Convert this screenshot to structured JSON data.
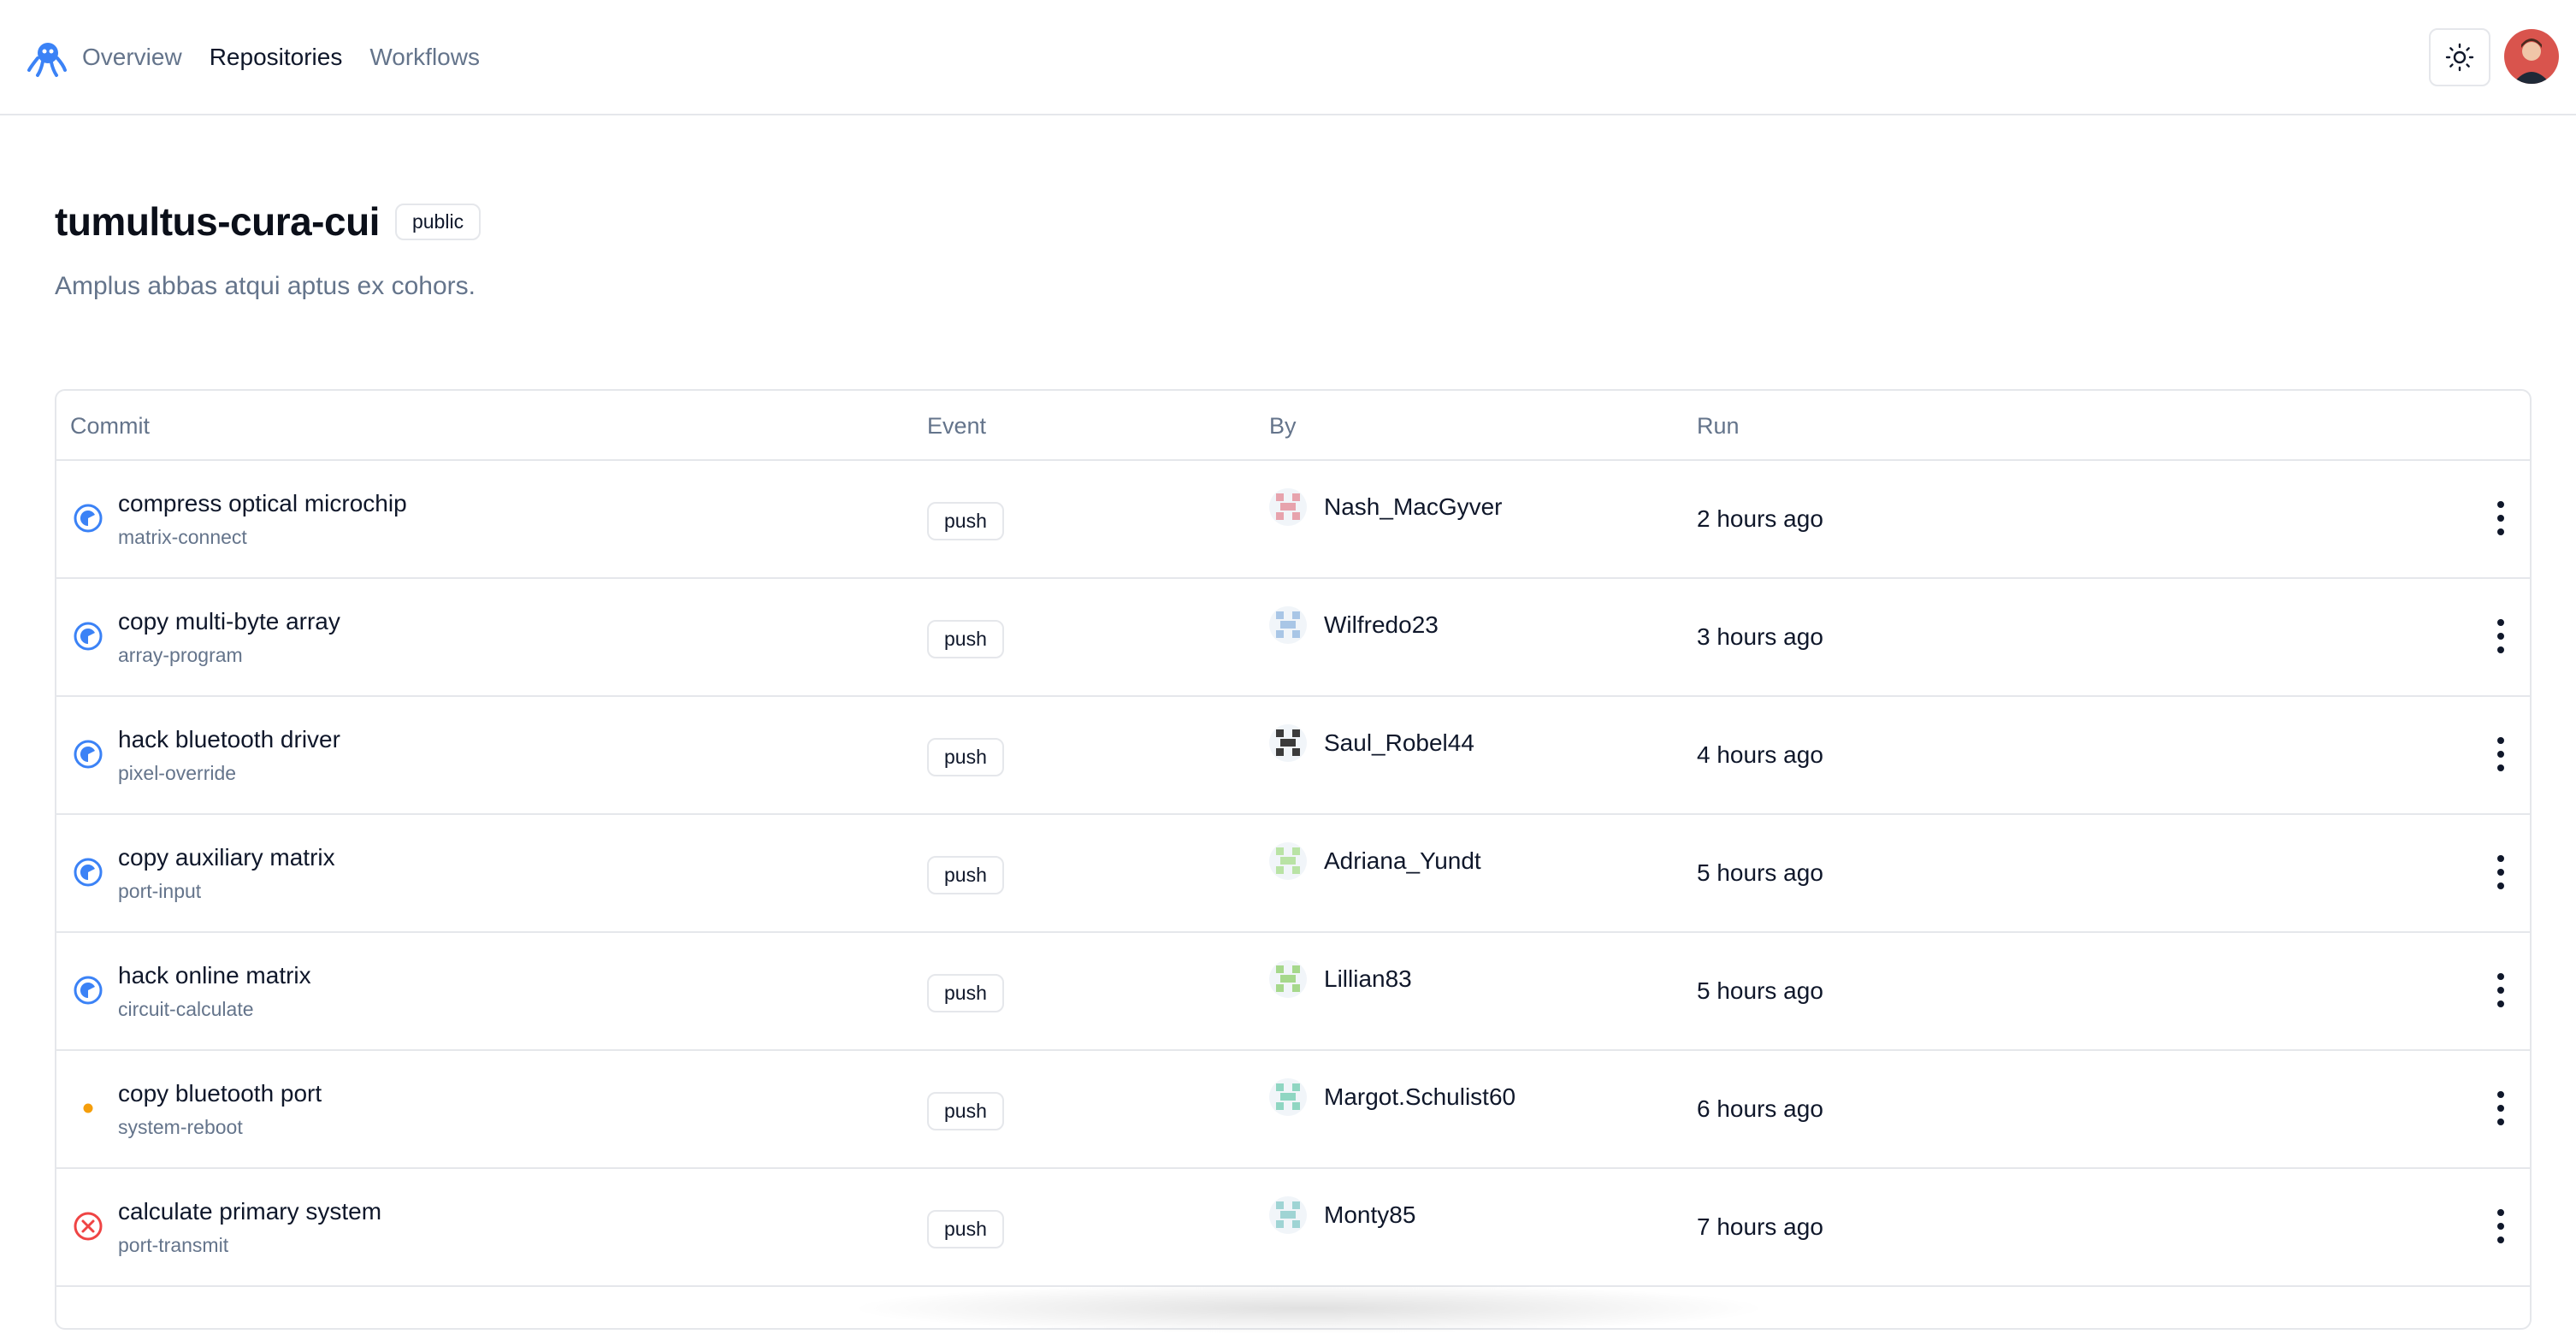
{
  "nav": {
    "logo_icon": "octopus-icon",
    "links": [
      {
        "label": "Overview",
        "active": false
      },
      {
        "label": "Repositories",
        "active": true
      },
      {
        "label": "Workflows",
        "active": false
      }
    ],
    "theme_icon": "sun-icon"
  },
  "repo": {
    "name": "tumultus-cura-cui",
    "visibility": "public",
    "description": "Amplus abbas atqui aptus ex cohors."
  },
  "table": {
    "headers": {
      "commit": "Commit",
      "event": "Event",
      "by": "By",
      "run": "Run"
    },
    "rows": [
      {
        "status": "running",
        "title": "compress optical microchip",
        "branch": "matrix-connect",
        "event": "push",
        "user": "Nash_MacGyver",
        "run": "2 hours ago",
        "avatar_color": "#e7a3ad"
      },
      {
        "status": "running",
        "title": "copy multi-byte array",
        "branch": "array-program",
        "event": "push",
        "user": "Wilfredo23",
        "run": "3 hours ago",
        "avatar_color": "#a9c6e6"
      },
      {
        "status": "running",
        "title": "hack bluetooth driver",
        "branch": "pixel-override",
        "event": "push",
        "user": "Saul_Robel44",
        "run": "4 hours ago",
        "avatar_color": "#3b3b3b"
      },
      {
        "status": "running",
        "title": "copy auxiliary matrix",
        "branch": "port-input",
        "event": "push",
        "user": "Adriana_Yundt",
        "run": "5 hours ago",
        "avatar_color": "#b9e3a5"
      },
      {
        "status": "running",
        "title": "hack online matrix",
        "branch": "circuit-calculate",
        "event": "push",
        "user": "Lillian83",
        "run": "5 hours ago",
        "avatar_color": "#a6d88c"
      },
      {
        "status": "queued",
        "title": "copy bluetooth port",
        "branch": "system-reboot",
        "event": "push",
        "user": "Margot.Schulist60",
        "run": "6 hours ago",
        "avatar_color": "#8fd6c2"
      },
      {
        "status": "failed",
        "title": "calculate primary system",
        "branch": "port-transmit",
        "event": "push",
        "user": "Monty85",
        "run": "7 hours ago",
        "avatar_color": "#9fd4d4"
      }
    ]
  },
  "colors": {
    "running": "#3b82f6",
    "queued": "#f59e0b",
    "failed": "#ef4444",
    "muted_text": "#64748b",
    "border": "#e5e7eb"
  }
}
